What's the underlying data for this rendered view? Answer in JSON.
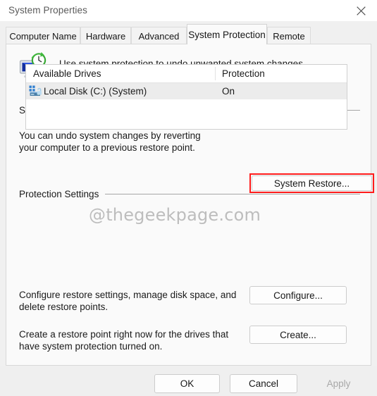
{
  "window": {
    "title": "System Properties",
    "close_icon": "close-icon"
  },
  "tabs": [
    {
      "label": "Computer Name",
      "active": false
    },
    {
      "label": "Hardware",
      "active": false
    },
    {
      "label": "Advanced",
      "active": false
    },
    {
      "label": "System Protection",
      "active": true
    },
    {
      "label": "Remote",
      "active": false
    }
  ],
  "header": {
    "icon": "system-protection-icon",
    "blurb": "Use system protection to undo unwanted system changes."
  },
  "system_restore": {
    "group_title": "System Restore",
    "description_line1": "You can undo system changes by reverting",
    "description_line2": "your computer to a previous restore point.",
    "button_label": "System Restore...",
    "highlight_color": "#ff1c1c"
  },
  "watermark": {
    "text": "@thegeekpage.com"
  },
  "protection_settings": {
    "group_title": "Protection Settings",
    "columns": [
      "Available Drives",
      "Protection"
    ],
    "rows": [
      {
        "icon": "hard-disk-icon",
        "drive": "Local Disk (C:) (System)",
        "protection": "On",
        "selected": true
      }
    ]
  },
  "configure": {
    "description_line1": "Configure restore settings, manage disk space, and",
    "description_line2": "delete restore points.",
    "button_label": "Configure..."
  },
  "create": {
    "description_line1": "Create a restore point right now for the drives that",
    "description_line2": "have system protection turned on.",
    "button_label": "Create..."
  },
  "dialog_buttons": {
    "ok": "OK",
    "cancel": "Cancel",
    "apply": "Apply",
    "apply_disabled": true
  }
}
